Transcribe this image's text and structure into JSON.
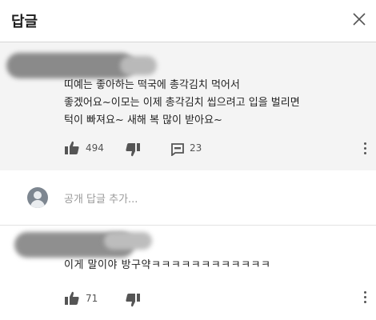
{
  "header": {
    "title": "답글",
    "close_icon": "close-icon"
  },
  "comments": [
    {
      "text": "띠예는 좋아하는 떡국에 총각김치 먹어서\n좋겠어요~이모는 이제 총각김치 씹으려고 입을 벌리면\n턱이 빠져요~ 새해 복 많이 받아요~",
      "likes": "494",
      "replies": "23"
    },
    {
      "text": "이게 말이야 방구약ㅋㅋㅋㅋㅋㅋㅋㅋㅋㅋㅋㅋ",
      "likes": "71"
    }
  ],
  "reply_input": {
    "placeholder": "공개 답글 추가..."
  },
  "colors": {
    "top_comment_bg": "#f4f4f4",
    "icon_gray": "#555555",
    "divider": "#e3e3e3"
  }
}
